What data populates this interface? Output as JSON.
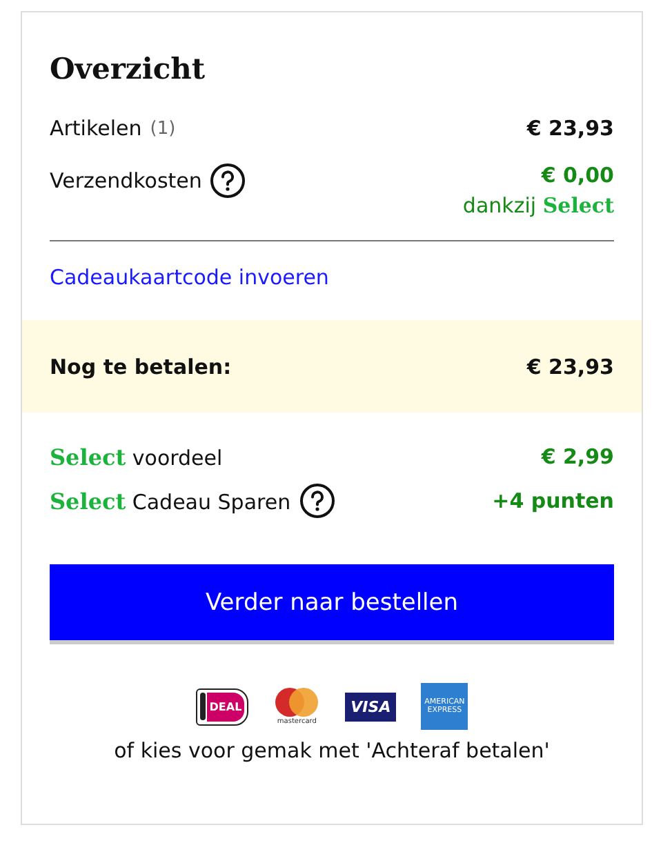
{
  "title": "Overzicht",
  "lines": [
    {
      "label": "Artikelen",
      "count": "(1)",
      "value": "€ 23,93",
      "kind": "plain"
    },
    {
      "label": "Verzendkosten",
      "help": true,
      "value": "€ 0,00",
      "note": "dankzij **Select**",
      "kind": "discount"
    }
  ],
  "gift_card_link": "Cadeaukaartcode invoeren",
  "total": {
    "label": "Nog te betalen:",
    "value": "€ 23,93"
  },
  "benefits": [
    {
      "label": "**Select** voordeel",
      "help": false,
      "value": "€ 2,99"
    },
    {
      "label": "**Select** Cadeau Sparen",
      "help": true,
      "value": "+4 punten"
    }
  ],
  "checkout_button": "Verder naar bestellen",
  "payment_methods": [
    {
      "kind": "ideal",
      "label": "DEAL"
    },
    {
      "kind": "mastercard",
      "label": "mastercard"
    },
    {
      "kind": "visa",
      "label": "VISA"
    },
    {
      "kind": "amex",
      "label": "AMERICAN EXPRESS"
    }
  ],
  "footer_note": "of kies voor gemak met 'Achteraf betalen'"
}
